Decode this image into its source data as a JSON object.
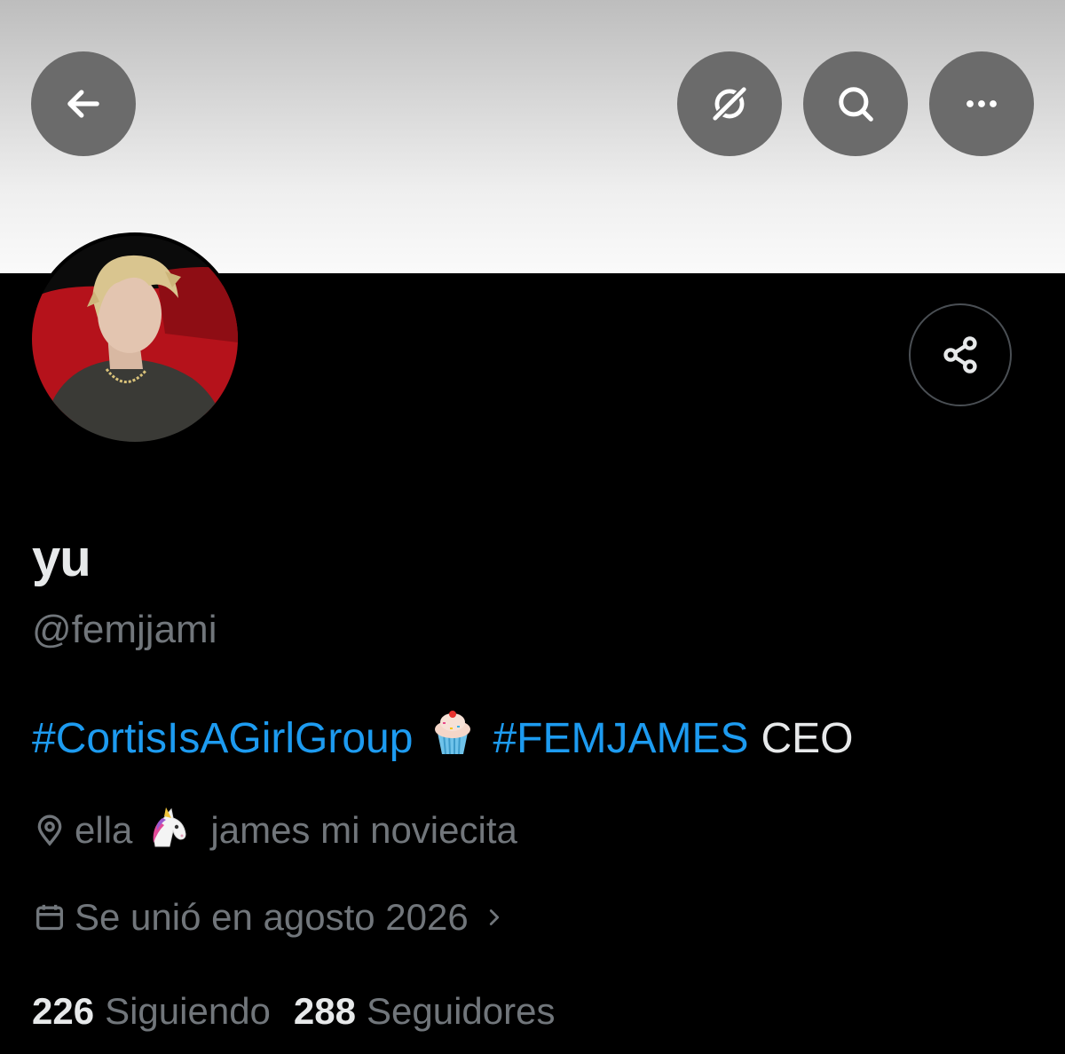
{
  "header": {
    "back_icon": "arrow-left-icon",
    "grok_icon": "grok-icon",
    "search_icon": "search-icon",
    "more_icon": "more-horizontal-icon"
  },
  "profile": {
    "display_name": "yu",
    "handle": "@femjjami",
    "bio": {
      "tag1": "#CortisIsAGirlGroup",
      "emoji1": "cupcake",
      "tag2": "#FEMJAMES",
      "text": "CEO"
    },
    "location": {
      "icon": "location-pin-icon",
      "part1": "ella",
      "emoji": "unicorn",
      "part2": "james mi noviecita"
    },
    "joined": {
      "icon": "calendar-icon",
      "text": "Se unió en agosto 2026",
      "chevron": "chevron-right-icon"
    },
    "following_count": "226",
    "following_label": "Siguiendo",
    "followers_count": "288",
    "followers_label": "Seguidores"
  },
  "actions": {
    "share_icon": "share-icon"
  },
  "colors": {
    "background": "#000000",
    "link": "#1d9bf0",
    "secondary_text": "#71767b",
    "primary_text": "#e7e9ea",
    "button_overlay": "#6b6b6b"
  }
}
